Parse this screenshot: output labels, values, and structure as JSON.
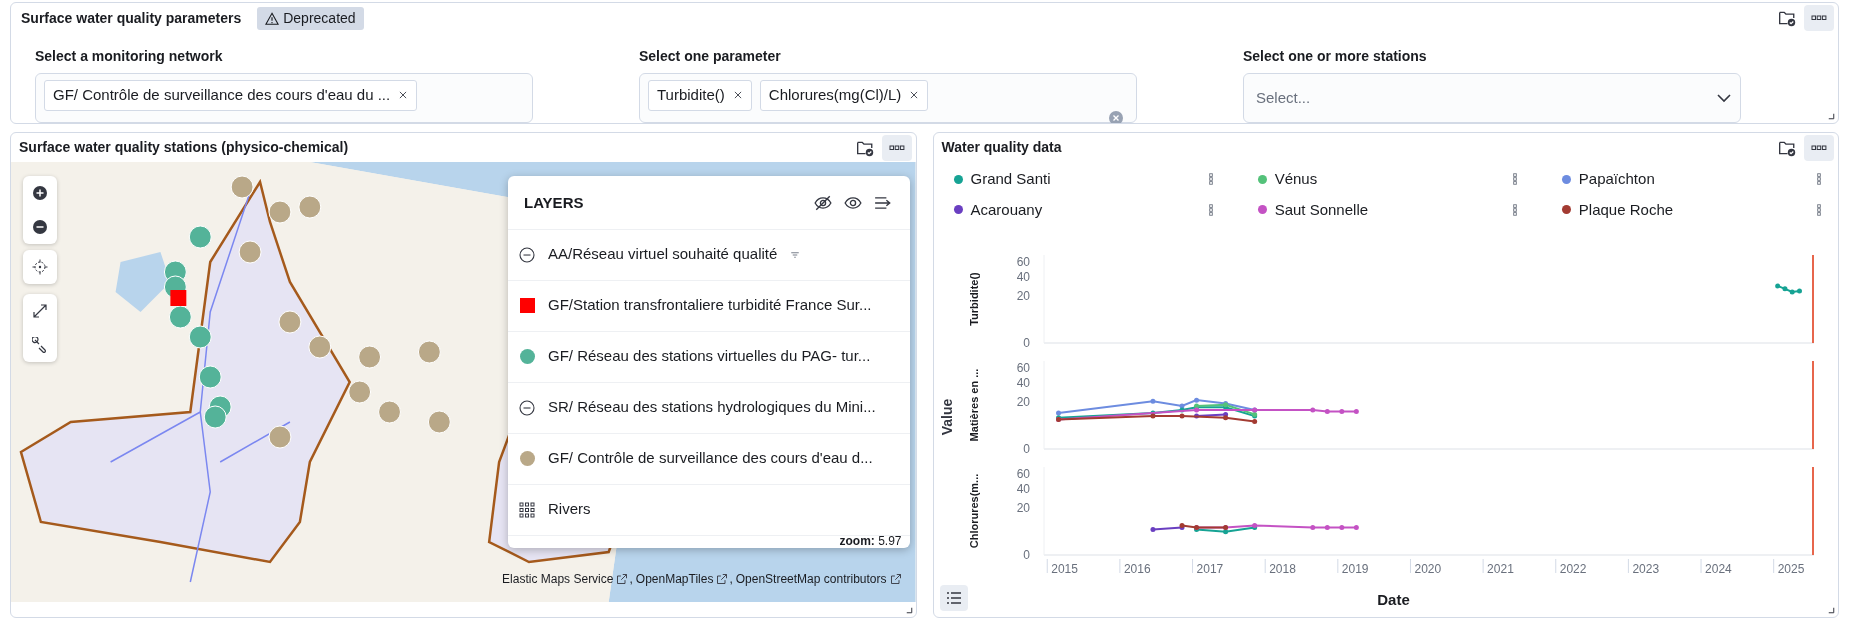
{
  "parameters_panel": {
    "title": "Surface water quality parameters",
    "badge": "Deprecated",
    "controls": [
      {
        "label": "Select a monitoring network",
        "tags": [
          "GF/ Contrôle de surveillance des cours d'eau du ..."
        ]
      },
      {
        "label": "Select one parameter",
        "tags": [
          "Turbidite()",
          "Chlorures(mg(Cl)/L)"
        ]
      },
      {
        "label": "Select one or more stations",
        "placeholder": "Select..."
      }
    ]
  },
  "map_panel": {
    "title": "Surface water quality stations (physico-chemical)",
    "layers": {
      "title": "LAYERS",
      "items": [
        {
          "kind": "hidden",
          "label": "AA/Réseau virtuel souhaité qualité",
          "filtered": true
        },
        {
          "kind": "square",
          "label": "GF/Station transfrontaliere turbidité France Sur...",
          "color": "#ff0000"
        },
        {
          "kind": "circle",
          "label": "GF/ Réseau des stations virtuelles du PAG- tur...",
          "color": "#54b399"
        },
        {
          "kind": "hidden",
          "label": "SR/ Réseau des stations hydrologiques du Mini..."
        },
        {
          "kind": "circle",
          "label": "GF/ Contrôle de surveillance des cours d'eau d...",
          "color": "#b9a888"
        },
        {
          "kind": "grid",
          "label": "Rivers"
        }
      ]
    },
    "zoom": "**zoom:** 5.97",
    "separator": ",",
    "attributions": [
      "Elastic Maps Service",
      "OpenMapTiles",
      "OpenStreetMap contributors"
    ]
  },
  "chart_panel": {
    "title": "Water quality data",
    "legend": [
      {
        "name": "Grand Santi",
        "color": "#16a394"
      },
      {
        "name": "Vénus",
        "color": "#54c27a"
      },
      {
        "name": "Papaïchton",
        "color": "#6d8ce0"
      },
      {
        "name": "Acarouany",
        "color": "#6a3fc1"
      },
      {
        "name": "Saut Sonnelle",
        "color": "#c452c4"
      },
      {
        "name": "Plaque Roche",
        "color": "#a33b32"
      }
    ],
    "yaxis_title": "Value",
    "xaxis_title": "Date",
    "xtick_labels": [
      "2015",
      "2016",
      "2017",
      "2018",
      "2019",
      "2020",
      "2021",
      "2022",
      "2023",
      "2024",
      "2025"
    ],
    "facets": [
      {
        "ylabel": "Turbidite()",
        "tick_labels": [
          "60",
          "40",
          "20",
          "0"
        ]
      },
      {
        "ylabel": "Matières en ...",
        "tick_labels": [
          "60",
          "40",
          "20",
          "0"
        ]
      },
      {
        "ylabel": "Chlorures(m...",
        "tick_labels": [
          "60",
          "40",
          "20",
          "0"
        ]
      }
    ]
  }
}
